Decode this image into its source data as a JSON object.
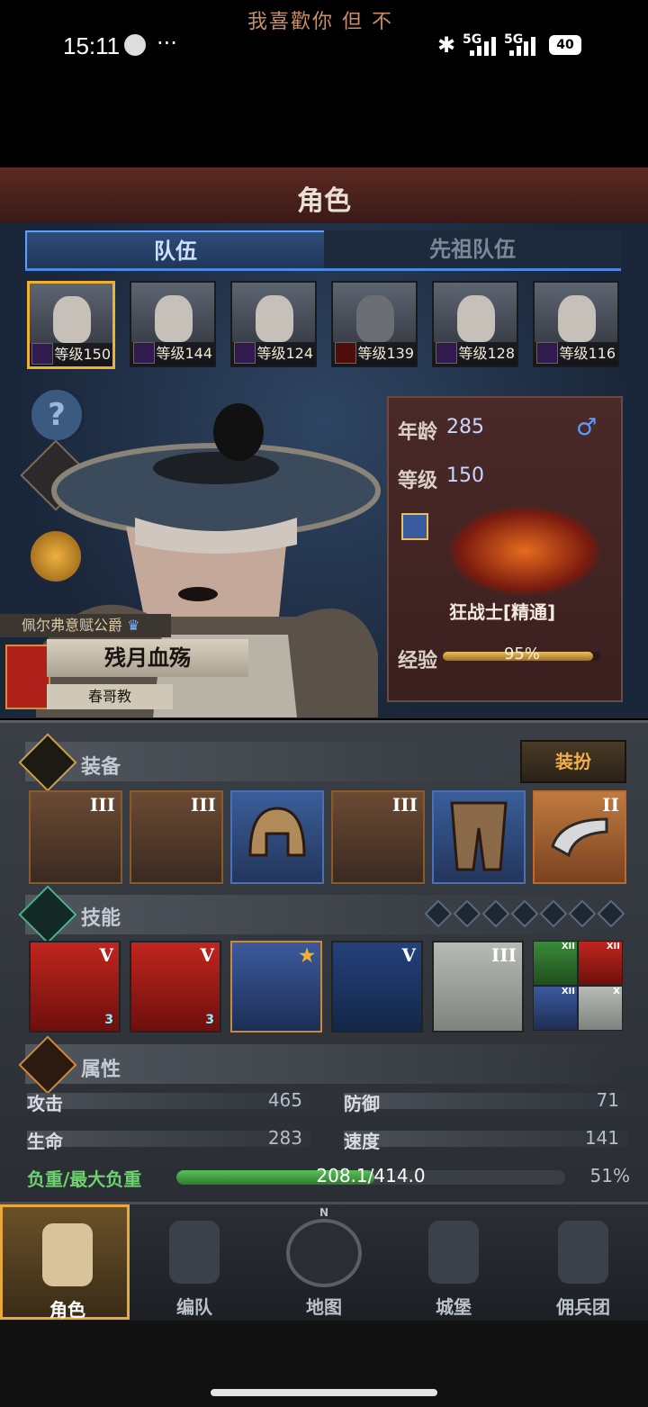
{
  "status_bar": {
    "marquee": "我喜歡你 但 不",
    "time": "15:11",
    "more": "···",
    "signal_1": "5G",
    "signal_2": "5G",
    "battery": "40"
  },
  "header": {
    "title": "角色"
  },
  "tabs": [
    {
      "label": "队伍",
      "selected": true
    },
    {
      "label": "先祖队伍",
      "selected": false
    }
  ],
  "team": [
    {
      "level": "等级150",
      "selected": true
    },
    {
      "level": "等级144"
    },
    {
      "level": "等级124"
    },
    {
      "level": "等级139"
    },
    {
      "level": "等级128"
    },
    {
      "level": "等级116"
    }
  ],
  "side_buttons": {
    "help": "?"
  },
  "character": {
    "title_rank": "佩尔弗意赋公爵",
    "name": "残月血殇",
    "faith": "春哥教",
    "age_label": "年龄",
    "age": "285",
    "gender": "♂",
    "level_label": "等级",
    "level": "150",
    "class_name": "狂战士[精通]",
    "exp_label": "经验",
    "exp_percent": "95%",
    "exp_fraction": 0.95
  },
  "equipment": {
    "title": "装备",
    "dress_button": "装扮",
    "items": [
      {
        "tier": "III",
        "name": "banner-weapon"
      },
      {
        "tier": "III",
        "name": "banner-weapon-2"
      },
      {
        "tier": "",
        "name": "helmet"
      },
      {
        "tier": "III",
        "name": "banner-armor"
      },
      {
        "tier": "",
        "name": "leg-armor"
      },
      {
        "tier": "II",
        "name": "horn-trinket"
      }
    ]
  },
  "skills": {
    "title": "技能",
    "slots": 7,
    "list": [
      {
        "tier": "V",
        "badge": "3"
      },
      {
        "tier": "V",
        "badge": "3"
      },
      {
        "tier": "★",
        "badge": ""
      },
      {
        "tier": "V",
        "badge": ""
      },
      {
        "tier": "III",
        "badge": ""
      }
    ],
    "mini": [
      {
        "tier": "XII"
      },
      {
        "tier": "XII"
      },
      {
        "tier": "XII"
      },
      {
        "tier": "X"
      }
    ]
  },
  "attributes": {
    "title": "属性",
    "attack_label": "攻击",
    "attack": "465",
    "defense_label": "防御",
    "defense": "71",
    "hp_label": "生命",
    "hp": "283",
    "speed_label": "速度",
    "speed": "141",
    "load_label": "负重/最大负重",
    "load": "208.1/414.0",
    "load_percent": "51%"
  },
  "nav": [
    {
      "label": "角色",
      "active": true
    },
    {
      "label": "编队"
    },
    {
      "label": "地图",
      "badge": "N"
    },
    {
      "label": "城堡"
    },
    {
      "label": "佣兵团"
    }
  ],
  "colors": {
    "accent": "#f0b030",
    "team_tab": "#4c88e0",
    "load_bar": "#4caf50"
  }
}
